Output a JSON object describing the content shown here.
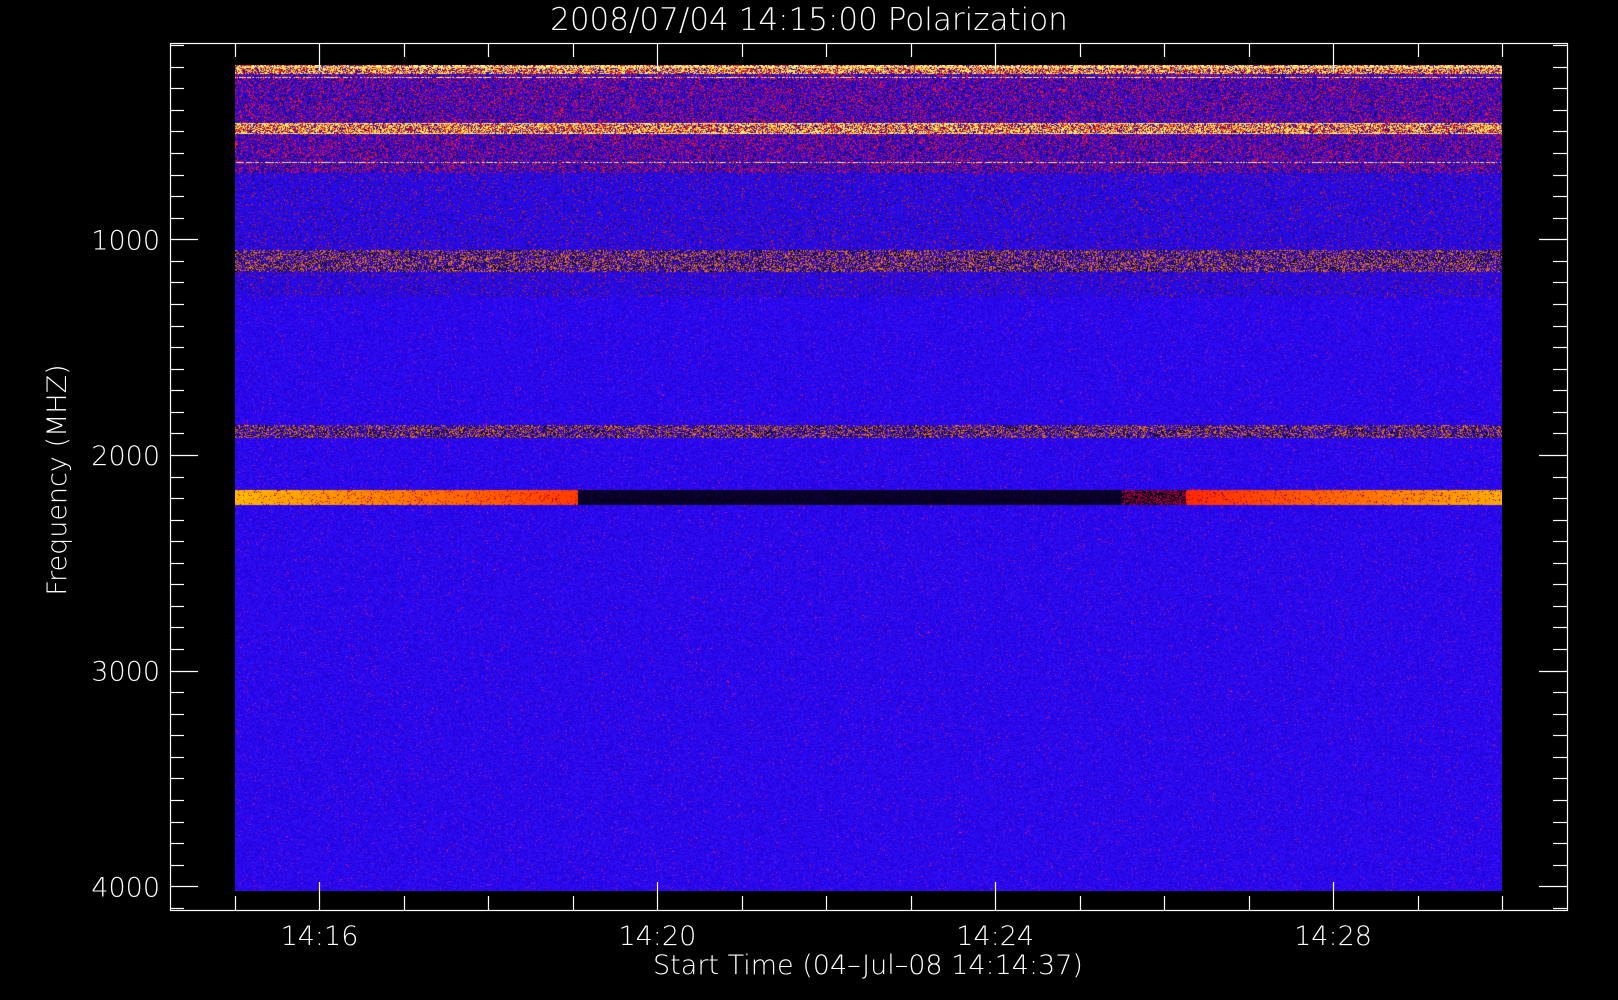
{
  "chart_data": {
    "type": "heatmap",
    "title": "2008/07/04 14:15:00 Polarization",
    "xlabel": "Start Time (04–Jul–08 14:14:37)",
    "ylabel": "Frequency (MHZ)",
    "x_ticks": [
      {
        "minutes_after_1415": 1,
        "label": "14:16"
      },
      {
        "minutes_after_1415": 5,
        "label": "14:20"
      },
      {
        "minutes_after_1415": 9,
        "label": "14:24"
      },
      {
        "minutes_after_1415": 13,
        "label": "14:28"
      }
    ],
    "x_minor_step_minutes": 1,
    "xlim_minutes_after_1415": [
      -0.77,
      15.77
    ],
    "data_x_range_minutes_after_1415": [
      0,
      15
    ],
    "y_ticks": [
      {
        "value": 1000,
        "label": "1000"
      },
      {
        "value": 2000,
        "label": "2000"
      },
      {
        "value": 3000,
        "label": "3000"
      },
      {
        "value": 4000,
        "label": "4000"
      }
    ],
    "y_minor_step": 100,
    "ylim_mhz": [
      90,
      4110
    ],
    "y_inverted": true,
    "data_y_range_mhz": [
      190,
      4020
    ],
    "colormap": [
      "#000000",
      "#1c00c8",
      "#2020ff",
      "#ff2a00",
      "#ffff40",
      "#ffffff"
    ],
    "background_level": "blue (low polarization) across band",
    "features": [
      {
        "freq_mhz": [
          190,
          230
        ],
        "description": "bright red/yellow interference lines",
        "t_range": [
          0,
          15
        ],
        "polarity": "strong"
      },
      {
        "freq_mhz": [
          460,
          510
        ],
        "description": "speckled yellow/white band",
        "t_range": [
          0,
          15
        ],
        "polarity": "strong"
      },
      {
        "freq_mhz": [
          1050,
          1150
        ],
        "description": "intermittent red/orange RFI",
        "t_range": [
          0,
          15
        ],
        "polarity": "mixed"
      },
      {
        "freq_mhz": [
          1860,
          1920
        ],
        "description": "faint red / black line",
        "t_range": [
          0,
          15
        ],
        "polarity": "mixed"
      },
      {
        "freq_mhz": [
          2160,
          2230
        ],
        "description": "strong red-yellow band turning black mid-interval",
        "t_range": [
          0,
          15
        ],
        "polarity": "reversing"
      }
    ]
  }
}
